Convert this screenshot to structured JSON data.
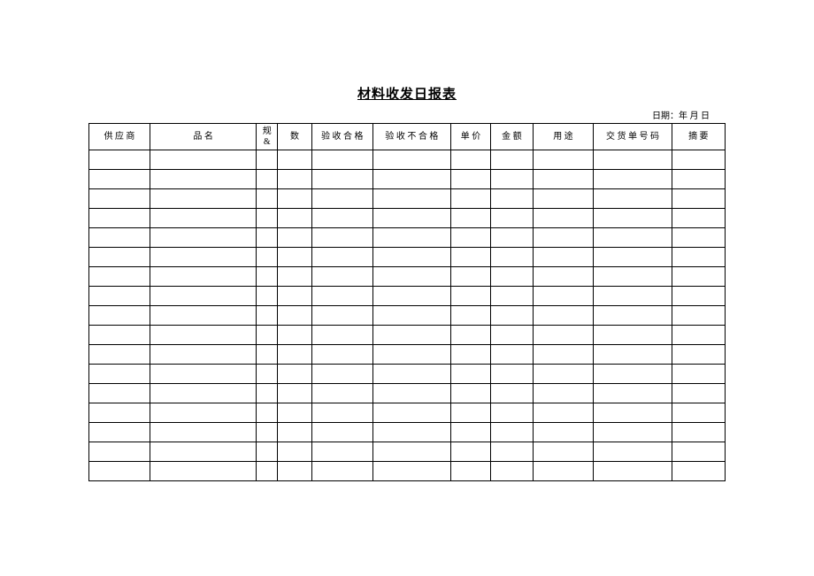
{
  "title": "材料收发日报表",
  "date_label": "日期：年 月 日",
  "headers": {
    "supplier": "供 应 商",
    "name": "品  名",
    "spec_line1": "规",
    "spec_line2": "&",
    "qty": "数",
    "pass": "验 收 合 格",
    "fail": "验 收 不 合 格",
    "price": "单 价",
    "amount": "金 额",
    "purpose": "用 途",
    "delivery": "交 货 单 号 码",
    "summary": "摘 要"
  },
  "row_count": 17
}
